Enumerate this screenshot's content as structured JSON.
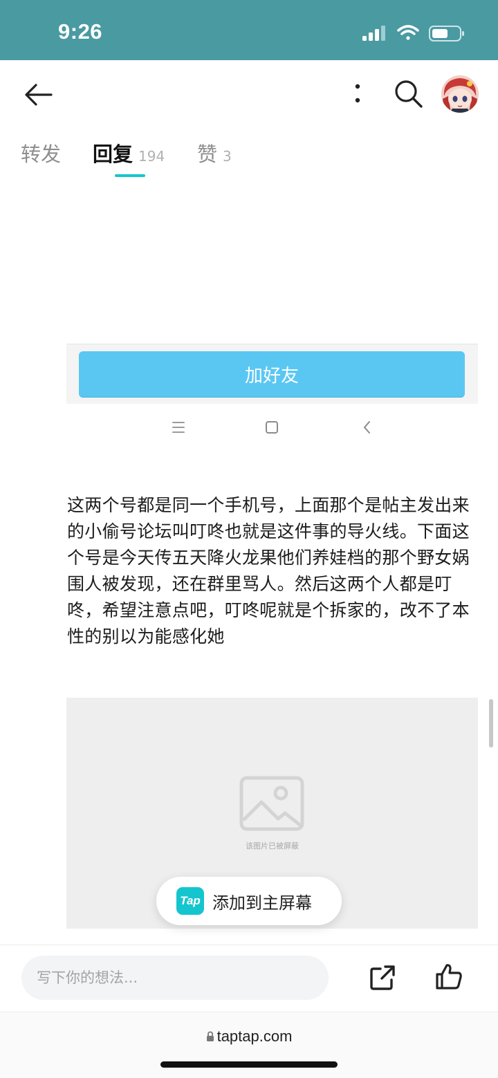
{
  "status_bar": {
    "time": "9:26"
  },
  "tabs": [
    {
      "label": "转发",
      "count": ""
    },
    {
      "label": "回复",
      "count": "194"
    },
    {
      "label": "赞",
      "count": "3"
    }
  ],
  "embedded_screenshot": {
    "add_friend_label": "加好友"
  },
  "post": {
    "text": "这两个号都是同一个手机号，上面那个是帖主发出来的小偷号论坛叫叮咚也就是这件事的导火线。下面这个号是今天传五天降火龙果他们养娃档的那个野女娲围人被发现，还在群里骂人。然后这两个人都是叮咚，希望注意点吧，叮咚呢就是个拆家的，改不了本性的别以为能感化她"
  },
  "blocked_image": {
    "caption": "该图片已被屏蔽"
  },
  "pwa_banner": {
    "logo_text": "Tap",
    "label": "添加到主屏幕"
  },
  "comment_bar": {
    "placeholder": "写下你的想法..."
  },
  "browser": {
    "url": "taptap.com"
  },
  "colors": {
    "status_bar": "#4a9aa2",
    "accent": "#15c5ce",
    "button_blue": "#5ac7f3"
  }
}
